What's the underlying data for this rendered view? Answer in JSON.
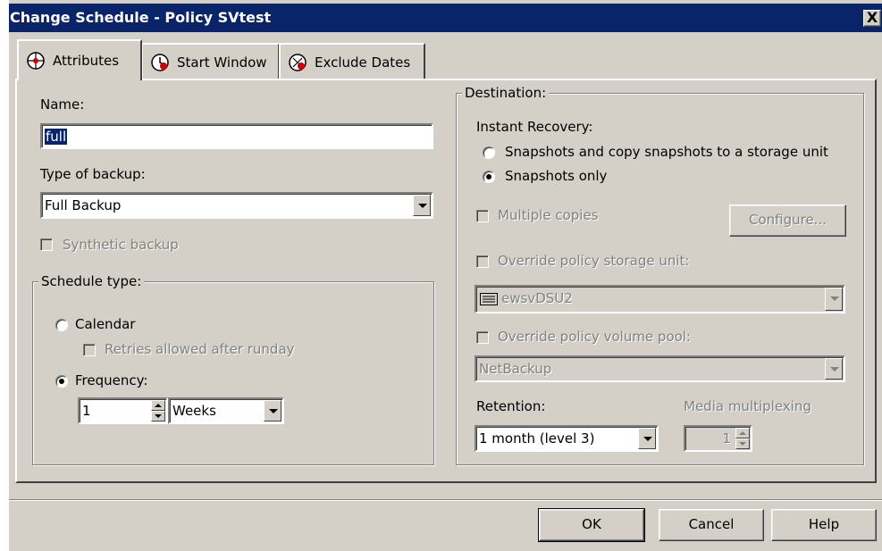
{
  "window": {
    "title": "Change Schedule - Policy SVtest",
    "close_glyph": "X"
  },
  "tabs": [
    {
      "label": "Attributes",
      "icon": "attributes-icon",
      "active": true
    },
    {
      "label": "Start Window",
      "icon": "start-window-icon",
      "active": false
    },
    {
      "label": "Exclude Dates",
      "icon": "exclude-dates-icon",
      "active": false
    }
  ],
  "attributes": {
    "name_label": "Name:",
    "name_value": "full",
    "type_label": "Type of backup:",
    "type_value": "Full Backup",
    "synthetic_label": "Synthetic backup",
    "synthetic_checked": false,
    "schedule_type": {
      "title": "Schedule type:",
      "calendar_label": "Calendar",
      "retries_label": "Retries allowed after runday",
      "frequency_label": "Frequency:",
      "frequency_value": "1",
      "frequency_unit": "Weeks",
      "selected": "frequency"
    }
  },
  "destination": {
    "title": "Destination:",
    "instant_recovery_label": "Instant Recovery:",
    "option_copy": "Snapshots and copy snapshots to a storage unit",
    "option_snapshots_only": "Snapshots only",
    "selected": "snapshots_only",
    "multiple_copies_label": "Multiple copies",
    "configure_label": "Configure...",
    "override_storage_label": "Override policy storage unit:",
    "storage_unit_value": "ewsvDSU2",
    "override_volume_label": "Override policy volume pool:",
    "volume_pool_value": "NetBackup",
    "retention_label": "Retention:",
    "retention_value": "1 month (level 3)",
    "multiplexing_label": "Media multiplexing",
    "multiplexing_value": "1"
  },
  "buttons": {
    "ok": "OK",
    "cancel": "Cancel",
    "help": "Help"
  },
  "colors": {
    "title_bar": "#0a246a",
    "face": "#d4d0c8",
    "disabled_text": "#808080"
  }
}
